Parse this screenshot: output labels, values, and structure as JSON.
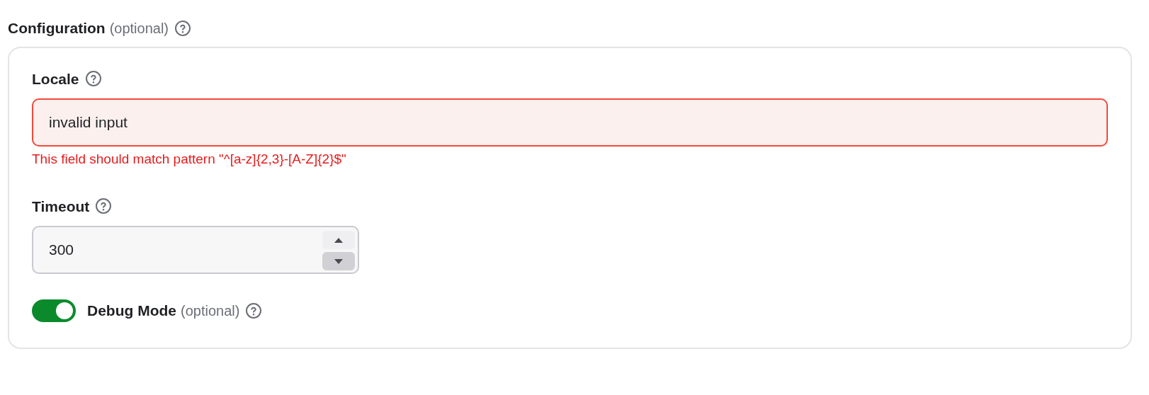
{
  "section": {
    "label": "Configuration",
    "optional_note": "(optional)"
  },
  "fields": [
    {
      "kind": "text",
      "label": "Locale",
      "value": "invalid input",
      "invalid": true,
      "error": "This field should match pattern \"^[a-z]{2,3}-[A-Z]{2}$\""
    },
    {
      "kind": "number",
      "label": "Timeout",
      "value": "300",
      "invalid": false,
      "stepper": [
        {
          "kind": "up",
          "pressed": false
        },
        {
          "kind": "down",
          "pressed": true
        }
      ]
    },
    {
      "kind": "switch",
      "label": "Debug Mode",
      "optional_note": "(optional)",
      "on": true
    }
  ]
}
